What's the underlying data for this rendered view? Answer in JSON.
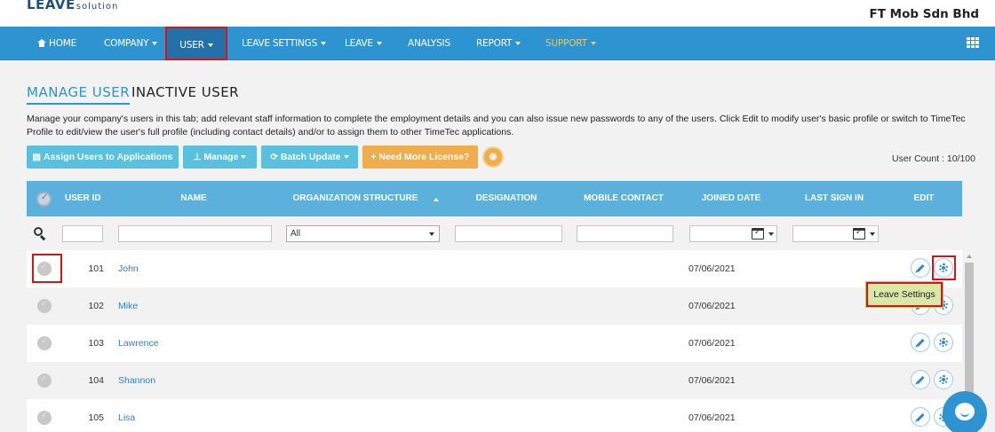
{
  "header": {
    "logo_main": "LEAVE",
    "logo_sub": "solution",
    "company_name": "FT Mob Sdn Bhd"
  },
  "nav": {
    "items": [
      {
        "label": "HOME"
      },
      {
        "label": "COMPANY"
      },
      {
        "label": "USER"
      },
      {
        "label": "LEAVE SETTINGS"
      },
      {
        "label": "LEAVE"
      },
      {
        "label": "ANALYSIS"
      },
      {
        "label": "REPORT"
      },
      {
        "label": "SUPPORT"
      }
    ],
    "active": "USER"
  },
  "tabs": {
    "manage": "MANAGE USER",
    "inactive": "INACTIVE USER"
  },
  "description": "Manage your company's users in this tab; add relevant staff information to complete the employment details and you can also issue new passwords to any of the users. Click Edit to modify user's basic profile or switch to TimeTec Profile to edit/view the user's full profile (including contact details) and/or to assign them to other TimeTec applications.",
  "toolbar": {
    "assign_label": "Assign Users to Applications",
    "manage_label": "Manage",
    "batch_label": "Batch Update",
    "license_label": "Need More License?"
  },
  "user_count": "User Count : 10/100",
  "table": {
    "columns": {
      "user_id": "USER ID",
      "name": "NAME",
      "org_structure": "ORGANIZATION STRUCTURE",
      "designation": "DESIGNATION",
      "mobile": "MOBILE CONTACT",
      "joined": "JOINED DATE",
      "last_sign_in": "LAST SIGN IN",
      "edit": "EDIT"
    },
    "filters": {
      "org_select": "All"
    },
    "rows": [
      {
        "id": "101",
        "name": "John",
        "joined": "07/06/2021"
      },
      {
        "id": "102",
        "name": "Mike",
        "joined": "07/06/2021"
      },
      {
        "id": "103",
        "name": "Lawrence",
        "joined": "07/06/2021"
      },
      {
        "id": "104",
        "name": "Shannon",
        "joined": "07/06/2021"
      },
      {
        "id": "105",
        "name": "Lisa",
        "joined": "07/06/2021"
      }
    ]
  },
  "tooltip": "Leave Settings",
  "colors": {
    "nav_blue": "#2e93d1",
    "table_header": "#5bb1db",
    "button_info": "#5bc0de",
    "button_warning": "#f0ad4e",
    "highlight_red": "#d8141a",
    "link_blue": "#2f7fc1",
    "support_gold": "#f5c74a"
  },
  "icons": [
    "home-icon",
    "grid-menu-icon",
    "users-icon",
    "sitemap-icon",
    "refresh-icon",
    "plus-icon",
    "lightbulb-icon",
    "search-icon",
    "calendar-icon",
    "pencil-icon",
    "gear-icon",
    "chat-icon"
  ]
}
